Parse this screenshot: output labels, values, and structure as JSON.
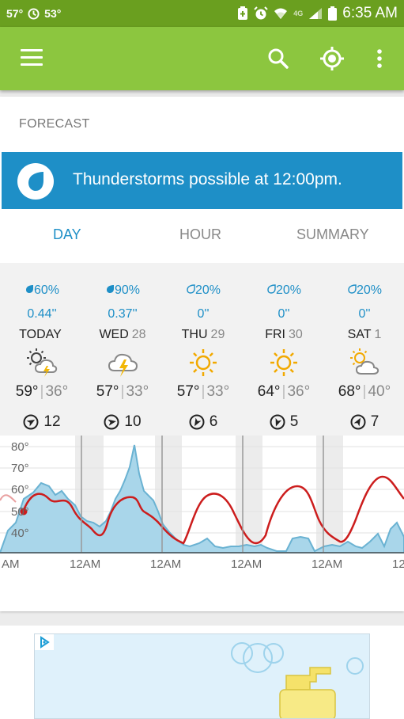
{
  "status_bar": {
    "temp_left": "57°",
    "temp_right": "53°",
    "network": "4G",
    "time": "6:35 AM"
  },
  "app_bar": {
    "icons": [
      "menu-icon",
      "search-icon",
      "location-icon",
      "more-icon"
    ],
    "color": "#8cc63f"
  },
  "forecast": {
    "section_title": "FORECAST",
    "alert_text": "Thunderstorms possible at 12:00pm.",
    "alert_color": "#1e8fc7",
    "tabs": [
      {
        "label": "DAY",
        "active": true
      },
      {
        "label": "HOUR",
        "active": false
      },
      {
        "label": "SUMMARY",
        "active": false
      }
    ],
    "days": [
      {
        "precip": "60%",
        "amount": "0.44''",
        "name": "TODAY",
        "num": "",
        "icon": "partly-sunny-thunder-icon",
        "high": "59°",
        "low": "36°",
        "wind": "12",
        "wind_dir_deg": 60
      },
      {
        "precip": "90%",
        "amount": "0.37''",
        "name": "WED",
        "num": "28",
        "icon": "thunderstorm-icon",
        "high": "57°",
        "low": "33°",
        "wind": "10",
        "wind_dir_deg": 80
      },
      {
        "precip": "20%",
        "amount": "0''",
        "name": "THU",
        "num": "29",
        "icon": "sunny-icon",
        "high": "57°",
        "low": "33°",
        "wind": "6",
        "wind_dir_deg": 210
      },
      {
        "precip": "20%",
        "amount": "0''",
        "name": "FRI",
        "num": "30",
        "icon": "sunny-icon",
        "high": "64°",
        "low": "36°",
        "wind": "5",
        "wind_dir_deg": 200
      },
      {
        "precip": "20%",
        "amount": "0''",
        "name": "SAT",
        "num": "1",
        "icon": "partly-cloudy-icon",
        "high": "68°",
        "low": "40°",
        "wind": "7",
        "wind_dir_deg": 30
      }
    ]
  },
  "chart_data": {
    "type": "line",
    "y_ticks": [
      "80°",
      "70°",
      "60°",
      "50°",
      "40°"
    ],
    "x_ticks": [
      "AM",
      "12AM",
      "12AM",
      "12AM",
      "12AM",
      "12"
    ],
    "temp_color": "#cc1d1d",
    "precip_color": "#73b9d6"
  }
}
